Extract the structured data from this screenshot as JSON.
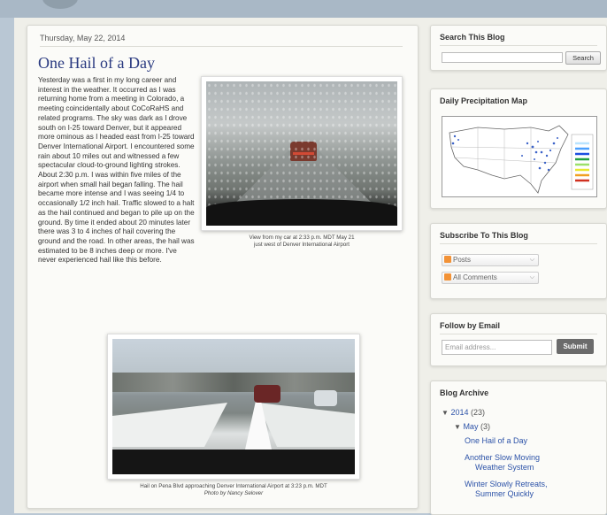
{
  "post": {
    "date": "Thursday, May 22, 2014",
    "title": "One Hail of a Day",
    "body": "Yesterday was a first in my long career and interest in the weather. It occurred as I was returning home from a meeting in Colorado, a meeting coincidentally about CoCoRaHS and related programs. The sky was dark as I drove south on I-25 toward Denver, but it appeared more ominous as I headed east from I-25 toward Denver International Airport. I encountered some rain about 10 miles out and witnessed a few spectacular cloud-to-ground lighting strokes. About 2:30 p.m. I was within five miles of the airport when small hail began falling. The hail became more intense and I was seeing 1/4 to occasionally 1/2 inch hail. Traffic slowed to a halt as the hail continued and began to pile up on the ground.  By time it ended about 20 minutes later there was 3 to 4 inches of hail covering the ground and the road. In other areas, the hail was estimated to be 8 inches deep or more. I've never experienced hail like this before.",
    "figure1": {
      "caption_line1": "View from my car at 2:33 p.m. MDT May 21",
      "caption_line2": "just west of Denver International Airport"
    },
    "figure2": {
      "caption_line1": "Hail on Pena Blvd approaching Denver International Airport at 3:23 p.m. MDT",
      "caption_line2": "Photo by Nancy Selover"
    }
  },
  "sidebar": {
    "search": {
      "title": "Search This Blog",
      "button": "Search"
    },
    "precip": {
      "title": "Daily Precipitation Map"
    },
    "subscribe": {
      "title": "Subscribe To This Blog",
      "posts": "Posts",
      "comments": "All Comments"
    },
    "follow": {
      "title": "Follow by Email",
      "placeholder": "Email address...",
      "submit": "Submit"
    },
    "archive": {
      "title": "Blog Archive",
      "year": "2014",
      "year_count": "(23)",
      "month": "May",
      "month_count": "(3)",
      "posts": [
        "One Hail of a Day",
        "Another Slow Moving",
        "Weather System",
        "Winter Slowly Retreats,",
        "Summer Quickly"
      ]
    }
  },
  "colors": {
    "title_blue": "#2a3a80",
    "link_blue": "#2d53a8",
    "rss_orange": "#f29236",
    "page_bg": "#b9c7d4"
  }
}
